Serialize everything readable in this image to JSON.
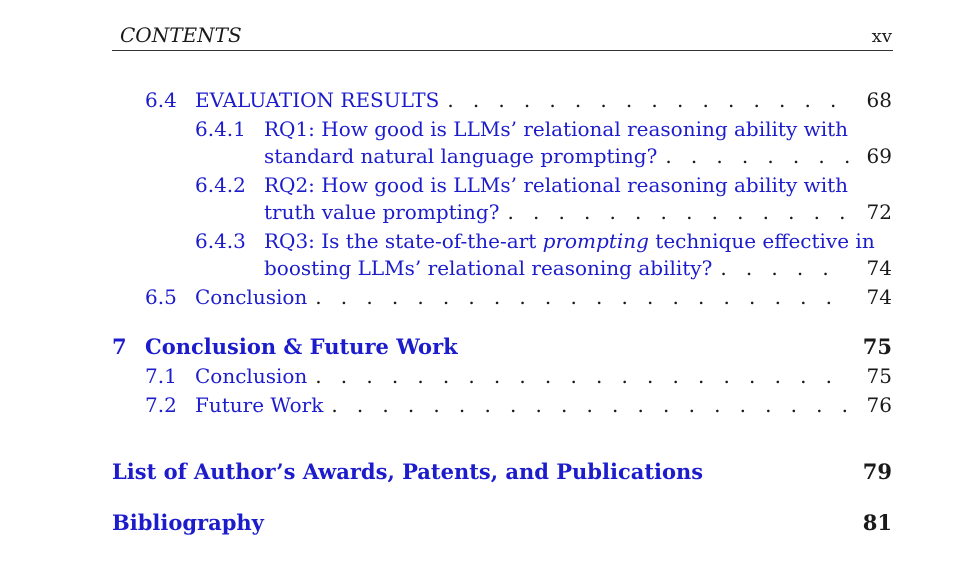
{
  "header": {
    "left": "CONTENTS",
    "right": "xv"
  },
  "entries": {
    "s6_4": {
      "num": "6.4",
      "title": "EVALUATION RESULTS",
      "page": "68"
    },
    "s6_4_1": {
      "num": "6.4.1",
      "line1": "RQ1: How good is LLMs’ relational reasoning ability with",
      "line2": "standard natural language prompting?",
      "page": "69"
    },
    "s6_4_2": {
      "num": "6.4.2",
      "line1": "RQ2: How good is LLMs’ relational reasoning ability with",
      "line2": "truth value prompting?",
      "page": "72"
    },
    "s6_4_3": {
      "num": "6.4.3",
      "line1_a": "RQ3: Is the state-of-the-art ",
      "line1_em": "prompting",
      "line1_b": " technique effective in",
      "line2": "boosting LLMs’ relational reasoning ability?",
      "page": "74"
    },
    "s6_5": {
      "num": "6.5",
      "title": "Conclusion",
      "page": "74"
    },
    "ch7": {
      "num": "7",
      "title": "Conclusion & Future Work",
      "page": "75"
    },
    "s7_1": {
      "num": "7.1",
      "title": "Conclusion",
      "page": "75"
    },
    "s7_2": {
      "num": "7.2",
      "title": "Future Work",
      "page": "76"
    },
    "awards": {
      "title": "List of Author’s Awards, Patents, and Publications",
      "page": "79"
    },
    "bib": {
      "title": "Bibliography",
      "page": "81"
    }
  },
  "dots": ". . . . . . . . . . . . . . . . . . . . . . . . . . . . . . . . . . . . . . . . . . . . . . . . . . . . . . . ."
}
